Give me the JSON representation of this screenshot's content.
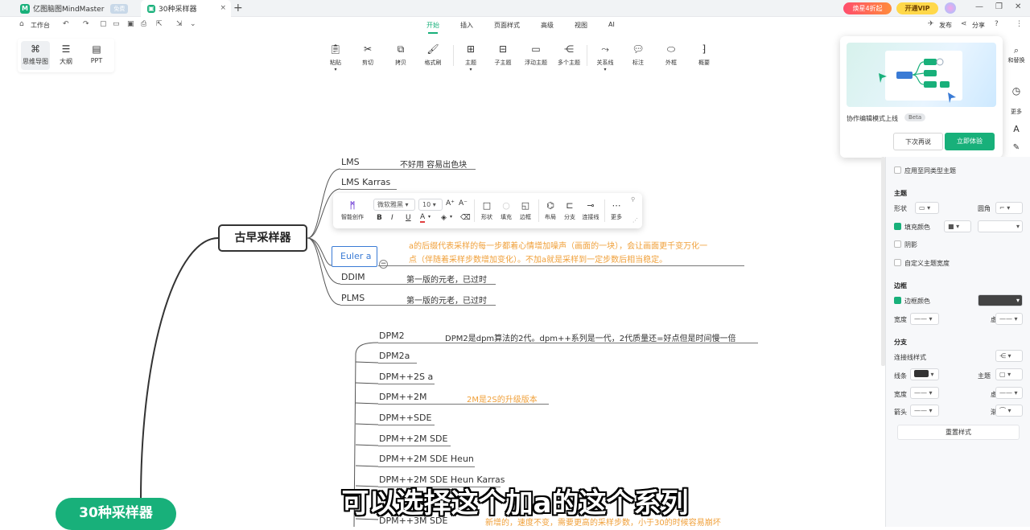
{
  "tabs": {
    "app_logo": "M",
    "app_title": "亿图脑图MindMaster",
    "app_badge": "免费",
    "doc_title": "30种采样器",
    "close": "×",
    "new_tab": "+"
  },
  "titlebar": {
    "promo": "焕星4折起",
    "vip": "开通VIP",
    "win_min": "—",
    "win_max": "❐",
    "win_close": "✕"
  },
  "menubar": {
    "workbench": "工作台",
    "items": [
      "开始",
      "插入",
      "页面样式",
      "高级",
      "视图",
      "AI"
    ],
    "publish": "发布",
    "share": "分享",
    "help": "?"
  },
  "view_modes": [
    "思维导图",
    "大纲",
    "PPT"
  ],
  "toolbar": [
    "粘贴",
    "剪切",
    "拷贝",
    "格式刷",
    "主题",
    "子主题",
    "浮动主题",
    "多个主题",
    "关系线",
    "标注",
    "外框",
    "概要"
  ],
  "popup": {
    "text": "协作编辑模式上线",
    "beta": "Beta",
    "later": "下次再说",
    "try": "立即体验"
  },
  "right_strip": [
    "和替换",
    "更多"
  ],
  "context_bar": {
    "ai": "智能创作",
    "font": "微软雅黑",
    "size": "10",
    "shape": "形状",
    "fill": "填充",
    "border": "边框",
    "layout": "布局",
    "branch": "分支",
    "connector": "连接线",
    "more": "更多"
  },
  "mindmap": {
    "central": "30种采样器",
    "topic": "古早采样器",
    "group1": [
      {
        "label": "LMS",
        "note": "不好用 容易出色块"
      },
      {
        "label": "LMS Karras",
        "note": ""
      },
      {
        "label": "Euler a",
        "note_line1": "a的后缀代表采样的每一步都着心情增加噪声（画面的一块），会让画面更千变万化一",
        "note_line2": "点（伴随着采样步数增加变化）。不加a就是采样到一定步数后相当稳定。"
      },
      {
        "label": "DDIM",
        "note": "第一版的元老，已过时"
      },
      {
        "label": "PLMS",
        "note": "第一版的元老，已过时"
      }
    ],
    "group2": [
      {
        "label": "DPM2",
        "note": "DPM2是dpm算法的2代。dpm++系列是一代，2代质量还=好点但是时间慢一倍"
      },
      {
        "label": "DPM2a",
        "note": ""
      },
      {
        "label": "DPM++2S a",
        "note": ""
      },
      {
        "label": "DPM++2M",
        "note": "2M是2S的升级版本"
      },
      {
        "label": "DPM++SDE",
        "note": ""
      },
      {
        "label": "DPM++2M SDE",
        "note": ""
      },
      {
        "label": "DPM++2M SDE Heun",
        "note": ""
      },
      {
        "label": "DPM++2M SDE Heun Karras",
        "note": ""
      },
      {
        "label": "DPM++3M SDE",
        "note": "新增的，速度不变，需要更高的采样步数，小于30的时候容易崩坏"
      }
    ]
  },
  "right_panel": {
    "apply_same": "应用至同类型主题",
    "theme_h": "主题",
    "shape": "形状",
    "corner": "圆角",
    "fill_color": "填充颜色",
    "shadow": "阴影",
    "custom_width": "自定义主题宽度",
    "border_h": "边框",
    "border_color": "边框颜色",
    "width": "宽度",
    "dash": "虚线",
    "branch_h": "分支",
    "connector_style": "连接线样式",
    "line": "线条",
    "topic": "主题",
    "width2": "宽度",
    "dash2": "虚线",
    "arrow": "箭头",
    "taper": "渐细",
    "reset": "重置样式"
  },
  "subtitle": "可以选择这个加a的这个系列",
  "colors": {
    "accent": "#18b07a",
    "note_orange": "#f0a03a",
    "select_blue": "#3a7bd5"
  }
}
